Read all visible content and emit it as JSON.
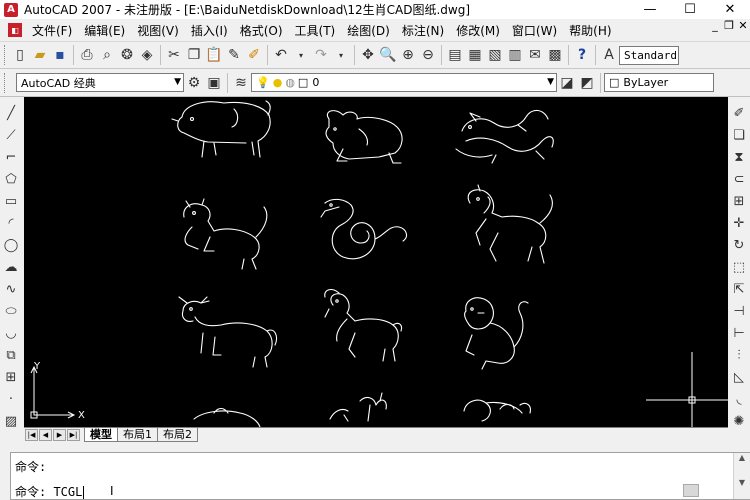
{
  "title_bar": {
    "title": "AutoCAD 2007 - 未注册版 - [E:\\BaiduNetdiskDownload\\12生肖CAD图纸.dwg]",
    "minimize": "—",
    "maximize": "☐",
    "close": "✕"
  },
  "menu": {
    "items": [
      "文件(F)",
      "编辑(E)",
      "视图(V)",
      "插入(I)",
      "格式(O)",
      "工具(T)",
      "绘图(D)",
      "标注(N)",
      "修改(M)",
      "窗口(W)",
      "帮助(H)"
    ],
    "mdi_minimize": "_",
    "mdi_restore": "❐",
    "mdi_close": "✕"
  },
  "toolbar": {
    "text_style_value": "Standard"
  },
  "toolbar2": {
    "workspace_value": "AutoCAD 经典",
    "layer_value": "0",
    "color_value": "ByLayer"
  },
  "layout_tabs": [
    "模型",
    "布局1",
    "布局2"
  ],
  "nav_buttons": [
    "|◀",
    "◀",
    "▶",
    "▶|"
  ],
  "ucs": {
    "x_label": "X",
    "y_label": "Y"
  },
  "command": {
    "prompt_line1": "命令:",
    "prompt_line2": "命令: TCGL"
  }
}
